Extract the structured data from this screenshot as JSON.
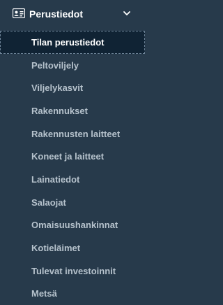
{
  "section": {
    "label": "Perustiedot",
    "icon": "id-card-icon",
    "chevron": "chevron-down-icon",
    "expanded": true
  },
  "menu": {
    "items": [
      {
        "label": "Tilan perustiedot",
        "active": true
      },
      {
        "label": "Peltoviljely"
      },
      {
        "label": "Viljelykasvit"
      },
      {
        "label": "Rakennukset"
      },
      {
        "label": "Rakennusten laitteet"
      },
      {
        "label": "Koneet ja laitteet"
      },
      {
        "label": "Lainatiedot"
      },
      {
        "label": "Salaojat"
      },
      {
        "label": "Omaisuushankinnat"
      },
      {
        "label": "Kotieläimet"
      },
      {
        "label": "Tulevat investoinnit"
      },
      {
        "label": "Metsä"
      }
    ]
  },
  "colors": {
    "background": "#273a4b",
    "active_background": "#102334",
    "item_text": "#b6c2cc",
    "active_text": "#ffffff"
  }
}
